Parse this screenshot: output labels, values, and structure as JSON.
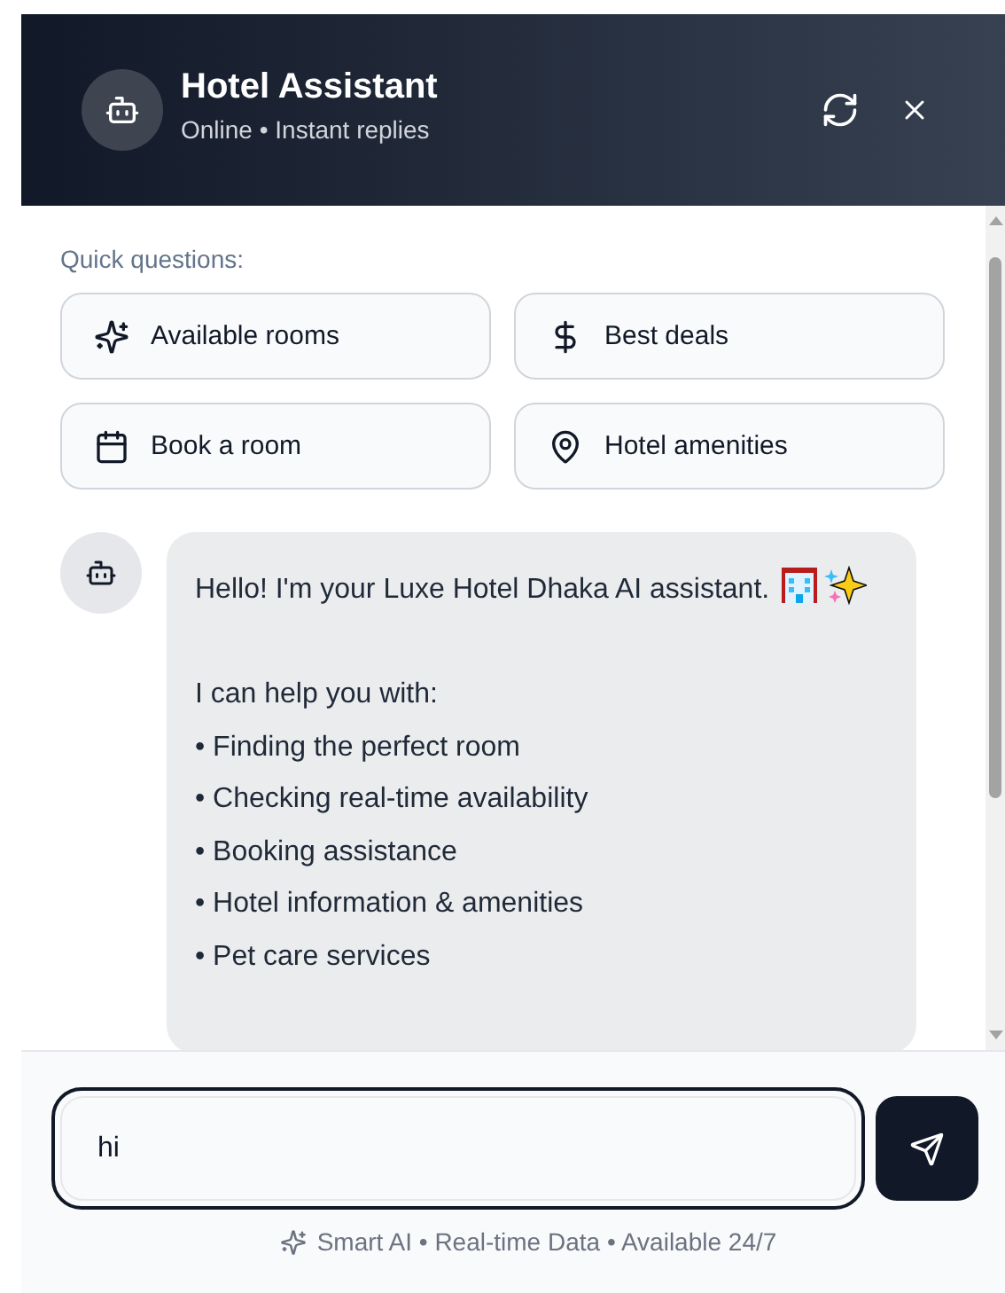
{
  "header": {
    "title": "Hotel Assistant",
    "subtitle": "Online • Instant replies"
  },
  "quick_questions": {
    "label": "Quick questions:",
    "items": [
      {
        "label": "Available rooms"
      },
      {
        "label": "Best deals"
      },
      {
        "label": "Book a room"
      },
      {
        "label": "Hotel amenities"
      }
    ]
  },
  "messages": [
    {
      "kind": "bot",
      "intro": "Hello! I'm your Luxe Hotel Dhaka AI assistant.",
      "heading": "I can help you with:",
      "items": [
        "• Finding the perfect room",
        "• Checking real-time availability",
        "• Booking assistance",
        "• Hotel information & amenities",
        "• Pet care services"
      ]
    }
  ],
  "composer": {
    "value": "hi",
    "footer": "Smart AI • Real-time Data • Available 24/7"
  }
}
